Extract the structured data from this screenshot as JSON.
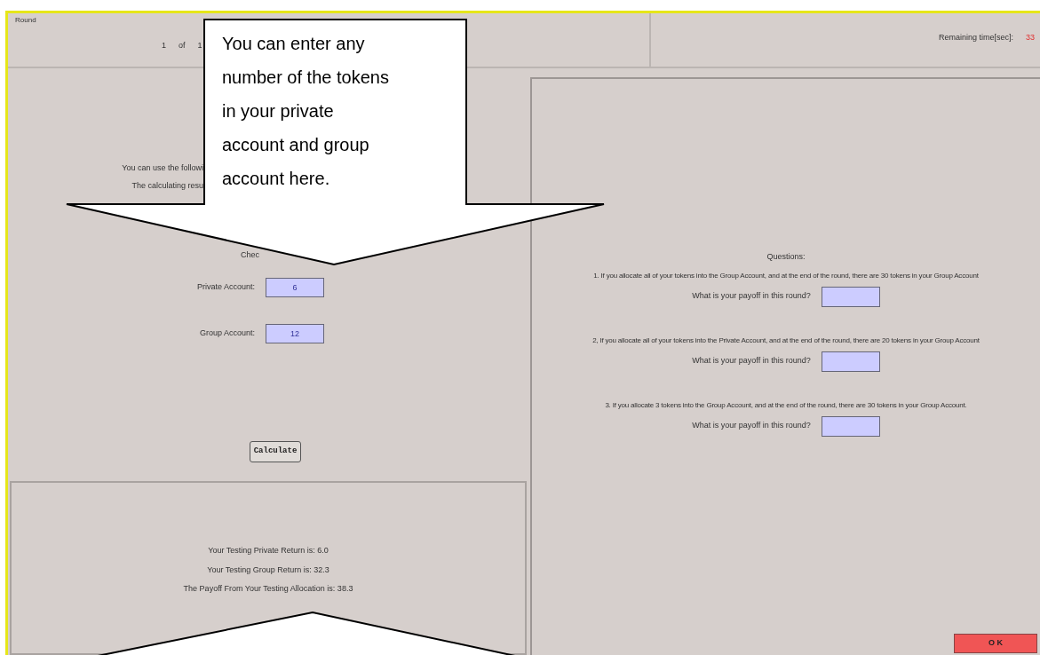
{
  "window": {
    "title": "Round"
  },
  "header": {
    "round": [
      "1",
      "of",
      "1"
    ],
    "timer_label": "Remaining time[sec]:",
    "timer_value": "33"
  },
  "instructions": [
    "You can use the followi",
    "The calculating resu",
    "Chec"
  ],
  "allocation": [
    {
      "label": "Private Account:",
      "value": "6"
    },
    {
      "label": "Group Account:",
      "value": "12"
    }
  ],
  "calculate_button": "Calculate",
  "results": [
    "Your Testing Private Return is: 6.0",
    "Your Testing Group Return is: 32.3",
    "The Payoff From Your Testing Allocation is: 38.3"
  ],
  "questions": {
    "title": "Questions:",
    "items": [
      {
        "text": "1.  If you allocate all of your tokens into the Group Account, and at the end of the round, there are 30 tokens in your Group Account",
        "prompt": "What is your payoff in this round?"
      },
      {
        "text": "2, If you allocate all of your tokens into the Private Account, and at the end of the round, there are 20 tokens in your Group Account",
        "prompt": "What is your payoff in this round?"
      },
      {
        "text": "3. If you allocate 3 tokens into the Group Account, and at the end of the round, there are 30 tokens in your Group Account.",
        "prompt": "What is your payoff in this round?"
      }
    ]
  },
  "ok_button": "O K",
  "callout": {
    "text": "You can enter any number of the tokens in your private account and group account here."
  }
}
